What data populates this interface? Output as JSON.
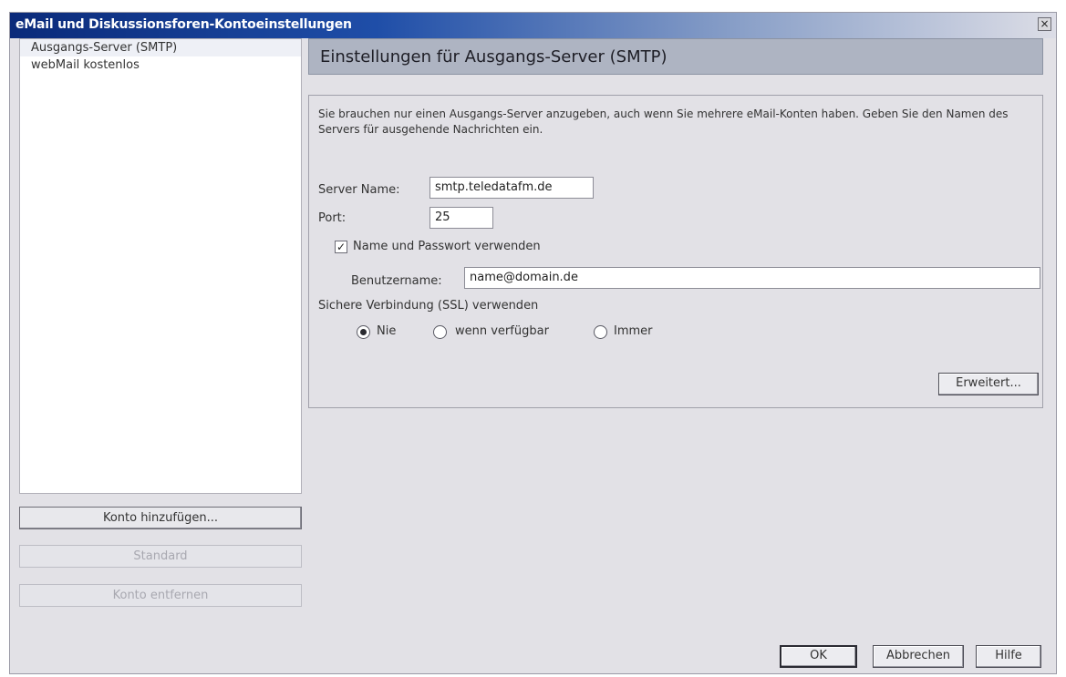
{
  "window": {
    "title": "eMail und Diskussionsforen-Kontoeinstellungen",
    "close_label": "×"
  },
  "accounts": {
    "items": [
      {
        "label": "Ausgangs-Server (SMTP)"
      },
      {
        "label": "webMail kostenlos"
      }
    ]
  },
  "left_buttons": {
    "add_account": "Konto hinzufügen...",
    "default": "Standard",
    "remove_account": "Konto entfernen"
  },
  "panel": {
    "header": "Einstellungen für Ausgangs-Server (SMTP)",
    "description": "Sie brauchen nur einen Ausgangs-Server anzugeben, auch wenn Sie mehrere eMail-Konten haben. Geben Sie den Namen des Servers für ausgehende Nachrichten ein."
  },
  "form": {
    "server_name_label": "Server Name:",
    "server_name_value": "smtp.teledatafm.de",
    "port_label": "Port:",
    "port_value": "25",
    "use_auth_label": "Name und Passwort verwenden",
    "use_auth_checked": "✓",
    "username_label": "Benutzername:",
    "username_value": "name@domain.de",
    "ssl_label": "Sichere Verbindung (SSL) verwenden",
    "ssl_options": [
      {
        "label": "Nie",
        "checked": true
      },
      {
        "label": "wenn verfügbar",
        "checked": false
      },
      {
        "label": "Immer",
        "checked": false
      }
    ],
    "advanced_button": "Erweitert..."
  },
  "footer": {
    "ok": "OK",
    "cancel": "Abbrechen",
    "help": "Hilfe"
  }
}
